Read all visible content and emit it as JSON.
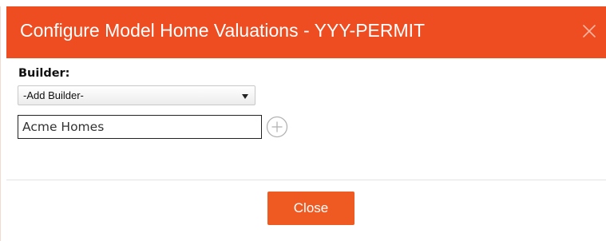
{
  "dialog": {
    "title": "Configure Model Home Valuations - YYY-PERMIT",
    "close_icon": "close-icon",
    "header_color": "#ee4d22"
  },
  "builder": {
    "label": "Builder:",
    "select_value": "-Add Builder-",
    "input_value": "Acme Homes",
    "add_icon": "plus-circle-icon"
  },
  "footer": {
    "close_label": "Close",
    "button_color": "#ee5a22"
  }
}
